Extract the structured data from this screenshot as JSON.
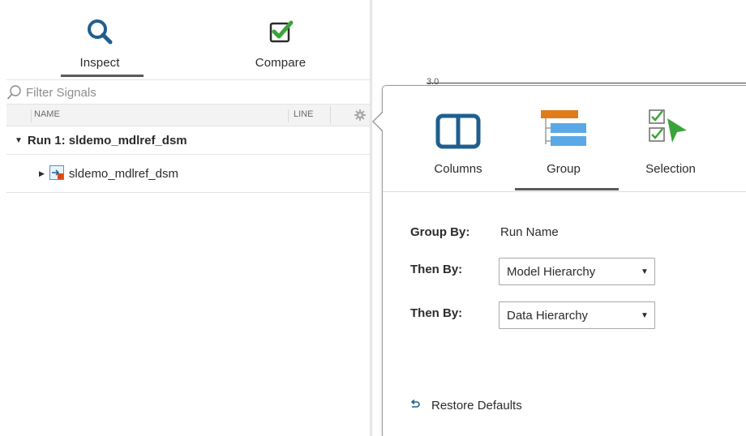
{
  "left_tabs": [
    {
      "label": "Inspect",
      "icon": "search-icon",
      "active": true
    },
    {
      "label": "Compare",
      "icon": "compare-checkbox-icon",
      "active": false
    }
  ],
  "filter": {
    "placeholder": "Filter Signals"
  },
  "columns": {
    "name": "NAME",
    "line": "LINE"
  },
  "tree": {
    "run_label": "Run 1: sldemo_mdlref_dsm",
    "signal_label": "sldemo_mdlref_dsm"
  },
  "plot": {
    "axis_tick": "3.0"
  },
  "popover": {
    "tabs": [
      {
        "label": "Columns",
        "icon": "columns-icon",
        "active": false
      },
      {
        "label": "Group",
        "icon": "group-icon",
        "active": true
      },
      {
        "label": "Selection",
        "icon": "selection-icon",
        "active": false
      }
    ],
    "group_by_label": "Group By:",
    "group_by_value": "Run Name",
    "then_by_1_label": "Then By:",
    "then_by_1_value": "Model Hierarchy",
    "then_by_2_label": "Then By:",
    "then_by_2_value": "Data Hierarchy",
    "restore_label": "Restore Defaults"
  },
  "colors": {
    "icon_blue": "#1f5f8f",
    "compare_green": "#3aa43a",
    "group_orange": "#e07b1a",
    "group_blue": "#5aa9e6",
    "selection_green": "#3aa43a",
    "restore_blue": "#1f5f8f"
  }
}
